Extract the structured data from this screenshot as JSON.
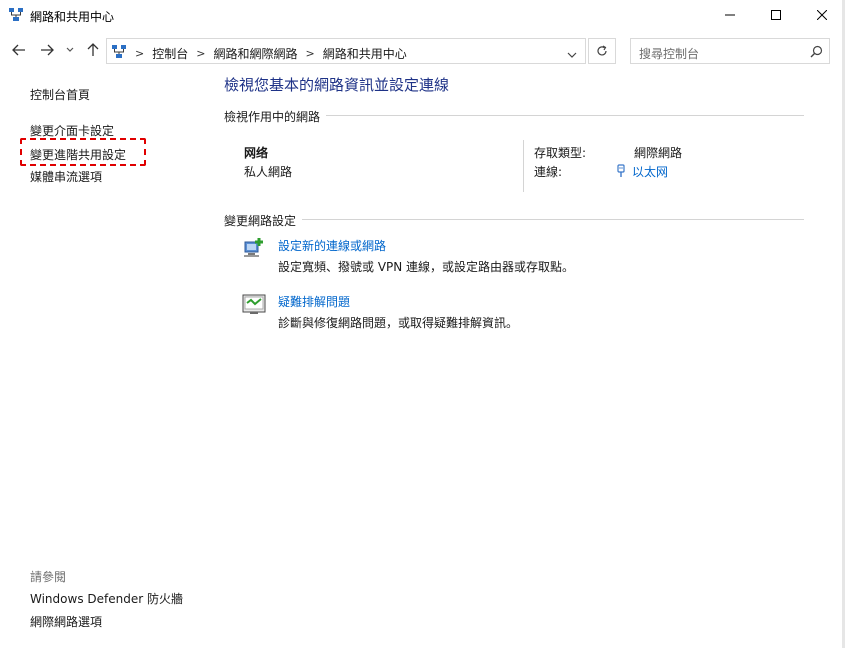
{
  "window": {
    "title": "網路和共用中心"
  },
  "navigation": {
    "breadcrumbs": [
      "控制台",
      "網路和網際網路",
      "網路和共用中心"
    ],
    "search_placeholder": "搜尋控制台"
  },
  "sidebar": {
    "links": [
      "控制台首頁",
      "變更介面卡設定",
      "變更進階共用設定",
      "媒體串流選項"
    ],
    "see_also_label": "請參閱",
    "see_also_links": [
      "Windows Defender 防火牆",
      "網際網路選項"
    ],
    "highlight_color": "#e00000"
  },
  "main": {
    "title": "檢視您基本的網路資訊並設定連線",
    "active_networks_header": "檢視作用中的網路",
    "network": {
      "name": "网络",
      "type": "私人網路",
      "access_type_label": "存取類型:",
      "access_type_value": "網際網路",
      "connection_label": "連線:",
      "connection_value": "以太网"
    },
    "change_settings_header": "變更網路設定",
    "tasks": [
      {
        "icon": "network-setup-icon",
        "link": "設定新的連線或網路",
        "description": "設定寬頻、撥號或 VPN 連線，或設定路由器或存取點。"
      },
      {
        "icon": "troubleshoot-icon",
        "link": "疑難排解問題",
        "description": "診斷與修復網路問題，或取得疑難排解資訊。"
      }
    ]
  },
  "colors": {
    "title_blue": "#1e3287",
    "link_blue": "#0066cc"
  }
}
